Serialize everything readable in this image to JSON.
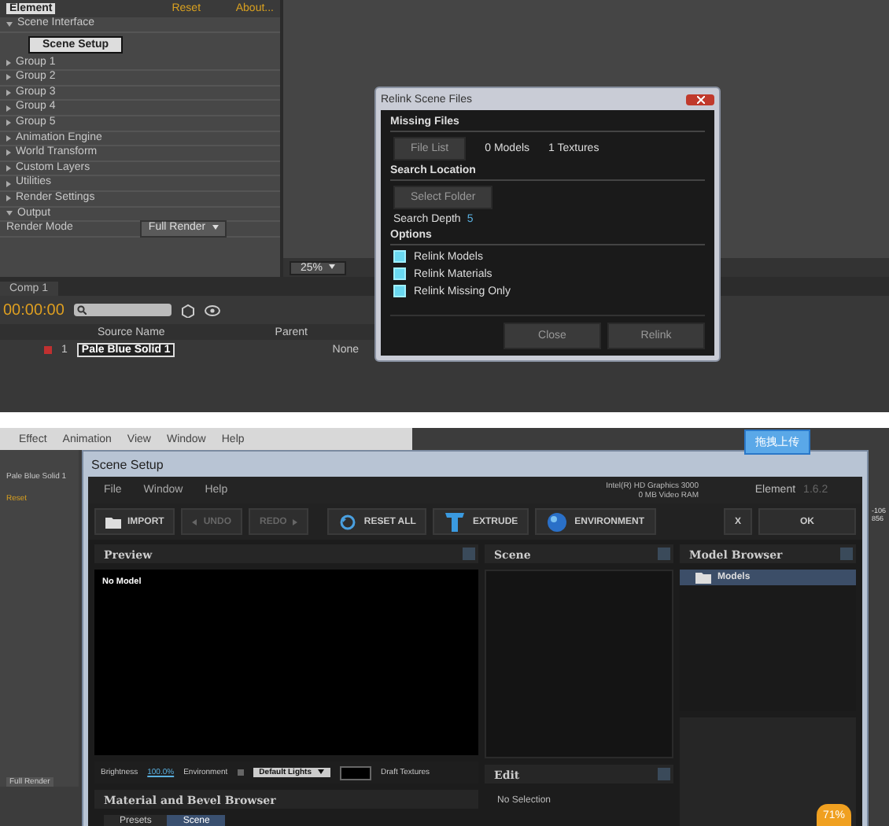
{
  "top": {
    "effect_controls": {
      "title": "Element",
      "reset": "Reset",
      "about": "About...",
      "items": [
        {
          "label": "Scene Interface",
          "expanded": true,
          "children": [
            {
              "kind": "button",
              "label": "Scene Setup"
            }
          ]
        },
        {
          "label": "Group 1",
          "expanded": false
        },
        {
          "label": "Group 2",
          "expanded": false
        },
        {
          "label": "Group 3",
          "expanded": false
        },
        {
          "label": "Group 4",
          "expanded": false
        },
        {
          "label": "Group 5",
          "expanded": false
        },
        {
          "label": "Animation Engine",
          "expanded": false
        },
        {
          "label": "World Transform",
          "expanded": false
        },
        {
          "label": "Custom Layers",
          "expanded": false
        },
        {
          "label": "Utilities",
          "expanded": false
        },
        {
          "label": "Render Settings",
          "expanded": false
        },
        {
          "label": "Output",
          "expanded": true,
          "children": [
            {
              "kind": "dropdown",
              "label": "Render Mode",
              "value": "Full Render"
            }
          ]
        }
      ]
    },
    "viewer": {
      "zoom": "25%"
    },
    "timeline": {
      "tab": "Comp 1",
      "timecode": "00:00:00",
      "columns": [
        "Source Name",
        "Parent"
      ],
      "layers": [
        {
          "number": "1",
          "name": "Pale Blue Solid 1",
          "parent": "None",
          "color": "#c03030"
        }
      ]
    },
    "dialog": {
      "title": "Relink Scene Files",
      "missing_title": "Missing Files",
      "file_list": "File List",
      "models": "0 Models",
      "textures": "1 Textures",
      "search_title": "Search Location",
      "select_folder": "Select Folder",
      "depth_label": "Search Depth",
      "depth_value": "5",
      "options_title": "Options",
      "options": [
        {
          "label": "Relink Models",
          "checked": true
        },
        {
          "label": "Relink Materials",
          "checked": true
        },
        {
          "label": "Relink Missing Only",
          "checked": true
        }
      ],
      "buttons": [
        "Close",
        "Relink"
      ]
    }
  },
  "bottom": {
    "menu": [
      "Effect",
      "Animation",
      "View",
      "Window",
      "Help"
    ],
    "layer_name": "Pale Blue Solid 1",
    "reset": "Reset",
    "render": "Full Render",
    "right_numbers": [
      "-106",
      "856"
    ],
    "upload_button": "拖拽上传",
    "speed_badge": "71%",
    "window": {
      "title": "Scene Setup",
      "menu": [
        "File",
        "Window",
        "Help"
      ],
      "gpu": "Intel(R) HD Graphics 3000",
      "vram": "0 MB Video RAM",
      "product": "Element",
      "version": "1.6.2",
      "toolbar": [
        {
          "kind": "import",
          "label": "IMPORT"
        },
        {
          "kind": "undo",
          "label": "UNDO"
        },
        {
          "kind": "redo",
          "label": "REDO"
        },
        {
          "kind": "reset",
          "label": "RESET ALL"
        },
        {
          "kind": "extrude",
          "label": "EXTRUDE"
        },
        {
          "kind": "environment",
          "label": "ENVIRONMENT"
        },
        {
          "kind": "close",
          "label": "X"
        },
        {
          "kind": "ok",
          "label": "OK"
        }
      ],
      "preview": {
        "title": "Preview",
        "message": "No Model",
        "brightness_label": "Brightness",
        "brightness": "100.0%",
        "environment_label": "Environment",
        "lights": "Default Lights",
        "draft": "Draft Textures"
      },
      "scene": {
        "title": "Scene"
      },
      "edit": {
        "title": "Edit",
        "message": "No Selection"
      },
      "model_browser": {
        "title": "Model Browser",
        "items": [
          {
            "label": "Models",
            "selected": true
          }
        ]
      },
      "material_browser": {
        "title": "Material and Bevel Browser",
        "tabs": [
          {
            "label": "Presets",
            "selected": false
          },
          {
            "label": "Scene",
            "selected": true
          }
        ]
      }
    }
  }
}
